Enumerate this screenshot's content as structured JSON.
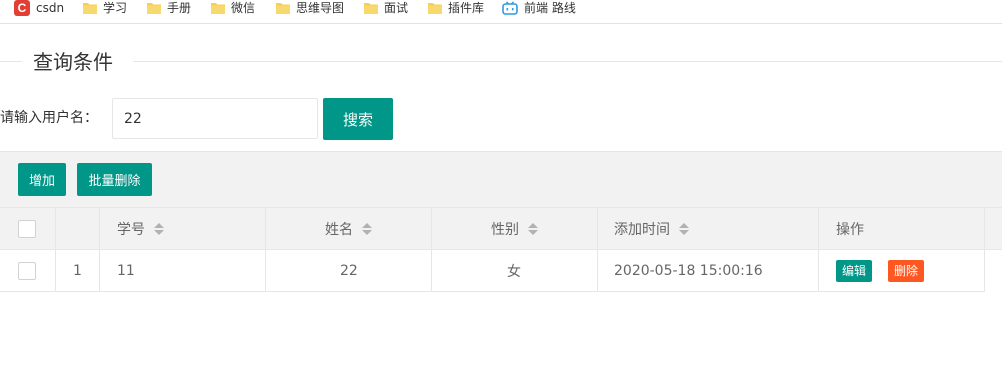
{
  "bookmarks": [
    {
      "label": "csdn",
      "icon": "csdn-icon"
    },
    {
      "label": "学习",
      "icon": "folder-icon"
    },
    {
      "label": "手册",
      "icon": "folder-icon"
    },
    {
      "label": "微信",
      "icon": "folder-icon"
    },
    {
      "label": "思维导图",
      "icon": "folder-icon"
    },
    {
      "label": "面试",
      "icon": "folder-icon"
    },
    {
      "label": "插件库",
      "icon": "folder-icon"
    },
    {
      "label": "前端 路线",
      "icon": "bilibili-icon"
    }
  ],
  "query": {
    "legend": "查询条件",
    "label": "请输入用户名：",
    "input_value": "22",
    "search_button": "搜索"
  },
  "toolbar": {
    "add_button": "增加",
    "batch_delete_button": "批量删除"
  },
  "table": {
    "columns": [
      "学号",
      "姓名",
      "性别",
      "添加时间",
      "操作"
    ],
    "rows": [
      {
        "index": "1",
        "id": "11",
        "name": "22",
        "gender": "女",
        "added_time": "2020-05-18 15:00:16",
        "edit_label": "编辑",
        "delete_label": "删除"
      }
    ]
  },
  "colors": {
    "primary": "#009688",
    "danger": "#ff5722",
    "header_bg": "#f2f2f2",
    "border": "#e6e6e6"
  }
}
